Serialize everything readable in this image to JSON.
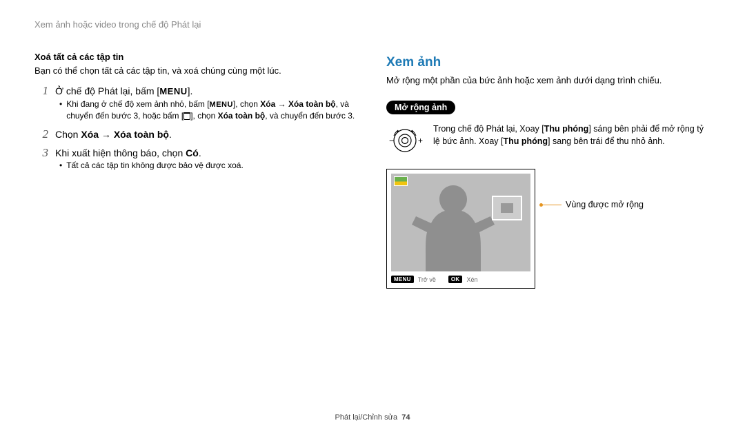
{
  "breadcrumb": "Xem ảnh hoặc video trong chế độ Phát lại",
  "left": {
    "sub_head": "Xoá tất cả các tập tin",
    "intro": "Bạn có thể chọn tất cả các tập tin, và xoá chúng cùng một lúc.",
    "steps": {
      "1": {
        "pre": "Ở chế độ Phát lại, bấm [",
        "menu": "MENU",
        "post": "].",
        "bullet_a": "Khi đang ở chế độ xem ảnh nhỏ, bấm [",
        "bullet_b": "], chọn ",
        "bullet_bold1": "Xóa → Xóa toàn bộ",
        "bullet_c": ", và chuyển đến bước 3, hoặc bấm [",
        "bullet_d": "], chọn ",
        "bullet_bold2": "Xóa toàn bộ",
        "bullet_e": ", và chuyển đến bước 3."
      },
      "2": {
        "pre": "Chọn ",
        "bold": "Xóa → Xóa toàn bộ",
        "post": "."
      },
      "3": {
        "pre": "Khi xuất hiện thông báo, chọn ",
        "bold": "Có",
        "post": ".",
        "bullet": "Tất cả các tập tin không được bảo vệ được xoá."
      }
    }
  },
  "right": {
    "h2": "Xem ảnh",
    "intro": "Mở rộng một phần của bức ảnh hoặc xem ảnh dưới dạng trình chiếu.",
    "pill": "Mở rộng ảnh",
    "zoom_minus": "−",
    "zoom_plus": "+",
    "zoom_a": "Trong chế độ Phát lại, Xoay [",
    "zoom_bold": "Thu phóng",
    "zoom_b": "] sáng bên phải để mở rộng tỷ lệ bức ảnh. Xoay [",
    "zoom_c": "] sang bên trái để thu nhỏ ảnh.",
    "footer_menu": "MENU",
    "footer_back": "Trở về",
    "footer_ok": "OK",
    "footer_crop": "Xén",
    "callout": "Vùng được mở rộng"
  },
  "footer": {
    "section": "Phát lại/Chỉnh sửa",
    "page": "74"
  }
}
